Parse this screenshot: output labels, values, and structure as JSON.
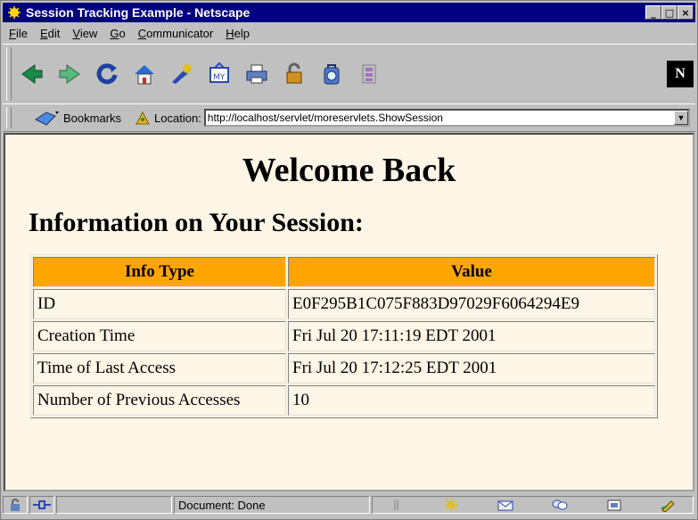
{
  "window": {
    "title": "Session Tracking Example - Netscape",
    "controls": [
      "_",
      "□",
      "×"
    ]
  },
  "menu": {
    "items": [
      {
        "key": "F",
        "rest": "ile"
      },
      {
        "key": "E",
        "rest": "dit"
      },
      {
        "key": "V",
        "rest": "iew"
      },
      {
        "key": "G",
        "rest": "o"
      },
      {
        "key": "C",
        "rest": "ommunicator"
      },
      {
        "key": "H",
        "rest": "elp"
      }
    ]
  },
  "toolbar": {
    "buttons": [
      "back-icon",
      "forward-icon",
      "reload-icon",
      "home-icon",
      "search-icon",
      "guide-icon",
      "print-icon",
      "security-icon",
      "shop-icon",
      "stop-icon"
    ],
    "logo": "N"
  },
  "location_bar": {
    "bookmarks_label": "Bookmarks",
    "location_label": "Location:",
    "url": "http://localhost/servlet/moreservlets.ShowSession"
  },
  "page": {
    "heading": "Welcome Back",
    "subheading": "Information on Your Session:",
    "table": {
      "headers": [
        "Info Type",
        "Value"
      ],
      "rows": [
        [
          "ID",
          "E0F295B1C075F883D97029F6064294E9"
        ],
        [
          "Creation Time",
          "Fri Jul 20 17:11:19 EDT 2001"
        ],
        [
          "Time of Last Access",
          "Fri Jul 20 17:12:25 EDT 2001"
        ],
        [
          "Number of Previous Accesses",
          "10"
        ]
      ]
    }
  },
  "status": {
    "text": "Document: Done"
  },
  "colors": {
    "titlebar": "#000080",
    "chrome": "#c0c0c0",
    "page_background": "#fdf5e6",
    "header_cells": "#ffa500"
  }
}
